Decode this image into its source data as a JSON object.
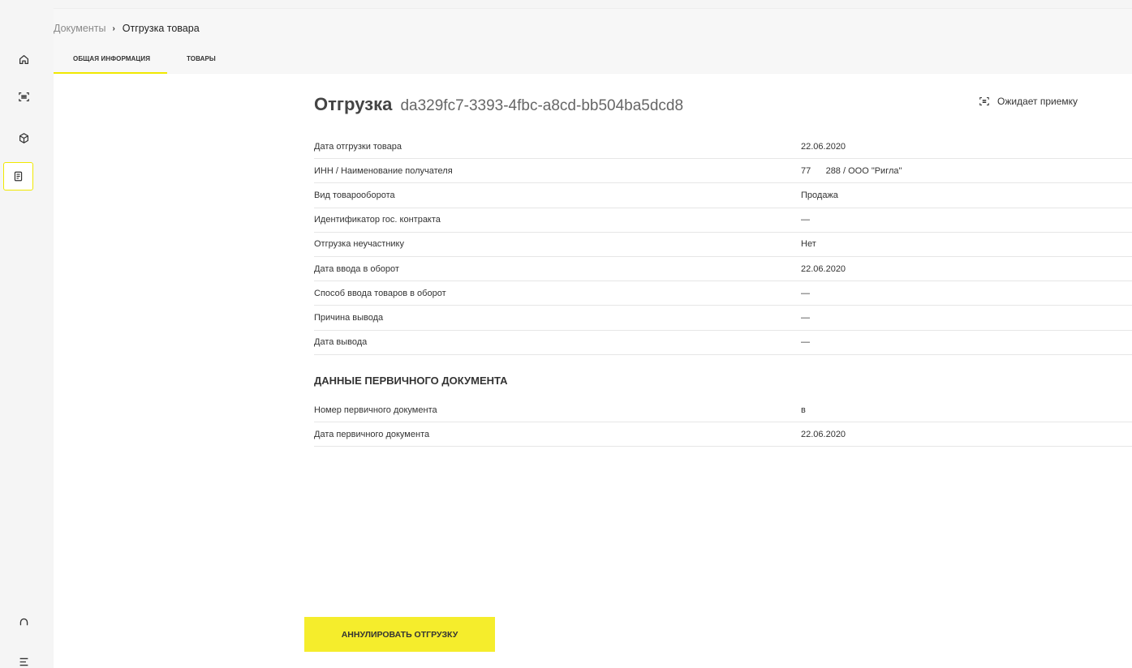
{
  "breadcrumb": {
    "parent": "Документы",
    "separator": "›",
    "current": "Отгрузка товара"
  },
  "tabs": [
    {
      "label": "ОБЩАЯ ИНФОРМАЦИЯ",
      "active": true
    },
    {
      "label": "ТОВАРЫ",
      "active": false
    }
  ],
  "sidebar": {
    "items": [
      {
        "icon": "home-icon"
      },
      {
        "icon": "scan-icon"
      },
      {
        "icon": "box-icon"
      },
      {
        "icon": "document-icon",
        "active": true
      },
      {
        "icon": "support-icon"
      },
      {
        "icon": "menu-icon"
      }
    ]
  },
  "document": {
    "title": "Отгрузка",
    "id": "da329fc7-3393-4fbc-a8cd-bb504ba5dcd8",
    "status": "Ожидает приемку"
  },
  "fields": [
    {
      "label": "Дата отгрузки товара",
      "value": "22.06.2020"
    },
    {
      "label": "ИНН / Наименование получателя",
      "value": "77      288 / ООО \"Ригла\""
    },
    {
      "label": "Вид товарооборота",
      "value": "Продажа"
    },
    {
      "label": "Идентификатор гос. контракта",
      "value": "—"
    },
    {
      "label": "Отгрузка неучастнику",
      "value": "Нет"
    },
    {
      "label": "Дата ввода в оборот",
      "value": "22.06.2020"
    },
    {
      "label": "Способ ввода товаров в оборот",
      "value": "—"
    },
    {
      "label": "Причина вывода",
      "value": "—"
    },
    {
      "label": "Дата вывода",
      "value": "—"
    }
  ],
  "primary_doc": {
    "section_title": "ДАННЫЕ ПЕРВИЧНОГО ДОКУМЕНТА",
    "fields": [
      {
        "label": "Номер первичного документа",
        "value": "в"
      },
      {
        "label": "Дата первичного документа",
        "value": "22.06.2020"
      }
    ]
  },
  "actions": {
    "cancel_label": "АННУЛИРОВАТЬ ОТГРУЗКУ"
  },
  "colors": {
    "accent": "#f5ed2c",
    "tab_underline": "#f0e800"
  }
}
